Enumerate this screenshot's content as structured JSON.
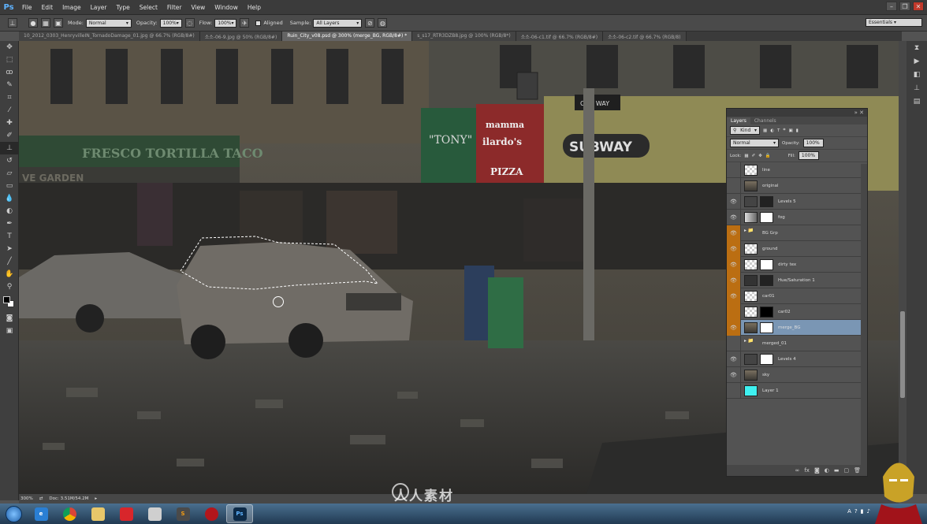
{
  "app": {
    "logo": "Ps"
  },
  "menu": [
    "File",
    "Edit",
    "Image",
    "Layer",
    "Type",
    "Select",
    "Filter",
    "View",
    "Window",
    "Help"
  ],
  "window_controls": [
    "minimize-icon",
    "restore-icon",
    "close-icon"
  ],
  "options": {
    "mode_label": "Mode:",
    "mode_value": "Normal",
    "opacity_label": "Opacity:",
    "opacity_value": "100%",
    "flow_label": "Flow:",
    "flow_value": "100%",
    "aligned_label": "Aligned",
    "sample_label": "Sample:",
    "sample_value": "All Layers",
    "workspace": "Essentials"
  },
  "tabs": [
    "10_2012_0303_HenryvilleIN_TornadoDamage_01.jpg @ 66.7% (RGB/8#)",
    "소소-06-9.jpg @ 50% (RGB/8#)",
    "Ruin_City_v08.psd @ 300% (merge_BG, RGB/8#) *",
    "s_s17_RTR3DZB8.jpg @ 100% (RGB/8*)",
    "소소-06-c1.tif @ 66.7% (RGB/8#)",
    "소소-06-c2.tif @ 66.7% (RGB/8)"
  ],
  "status": {
    "zoom": "300%",
    "doc": "Doc: 3.51M/54.2M"
  },
  "scene": {
    "signs": [
      "FRESCO TORTILLA TACO",
      "VE GARDEN",
      "\"TONY\"",
      "mamma",
      "ilardo's",
      "PIZZA",
      "SUBWAY",
      "ONE WAY"
    ]
  },
  "layers_panel": {
    "tabs": [
      "Layers",
      "Channels"
    ],
    "filter_kind": "Kind",
    "blend_mode": "Normal",
    "opacity_label": "Opacity:",
    "opacity_value": "100%",
    "lock_label": "Lock:",
    "fill_label": "Fill:",
    "fill_value": "100%",
    "layers": [
      {
        "name": "line",
        "visible": false,
        "orange": false,
        "thumb": "checker",
        "mask": ""
      },
      {
        "name": "original",
        "visible": false,
        "orange": false,
        "thumb": "photo",
        "mask": ""
      },
      {
        "name": "Levels 5",
        "visible": true,
        "orange": false,
        "thumb": "levels",
        "mask": "dark"
      },
      {
        "name": "fog",
        "visible": true,
        "orange": false,
        "thumb": "gray",
        "mask": "white"
      },
      {
        "name": "BG Grp",
        "visible": true,
        "orange": true,
        "thumb": "folder",
        "mask": ""
      },
      {
        "name": "ground",
        "visible": true,
        "orange": true,
        "thumb": "checker",
        "mask": ""
      },
      {
        "name": "dirty tex",
        "visible": true,
        "orange": true,
        "thumb": "checker",
        "mask": "white"
      },
      {
        "name": "Hue/Saturation 1",
        "visible": true,
        "orange": true,
        "thumb": "hue",
        "mask": "dark"
      },
      {
        "name": "car01",
        "visible": true,
        "orange": true,
        "thumb": "checker",
        "mask": ""
      },
      {
        "name": "car02",
        "visible": false,
        "orange": true,
        "thumb": "checker",
        "mask": "black"
      },
      {
        "name": "merge_BG",
        "visible": true,
        "orange": true,
        "thumb": "photo",
        "mask": "white",
        "selected": true
      },
      {
        "name": "merged_01",
        "visible": false,
        "orange": false,
        "thumb": "folder",
        "mask": ""
      },
      {
        "name": "Levels 4",
        "visible": true,
        "orange": false,
        "thumb": "levels",
        "mask": "white"
      },
      {
        "name": "sky",
        "visible": true,
        "orange": false,
        "thumb": "photo",
        "mask": ""
      },
      {
        "name": "Layer 1",
        "visible": false,
        "orange": false,
        "thumb": "cyan",
        "mask": ""
      }
    ]
  },
  "taskbar": {
    "apps": [
      "ie-icon",
      "chrome-icon",
      "explorer-icon",
      "app-red-icon",
      "app-dice-icon",
      "sublime-icon",
      "ladybug-icon",
      "photoshop-icon"
    ],
    "ps_label": "Ps",
    "tray_text": "A"
  },
  "watermark": "人人素材",
  "colors": {
    "accent_selected": "#7a96b4",
    "group_orange": "#bb6e12",
    "ps_blue": "#5fb3ff",
    "cyan_layer": "#3ff1f1"
  }
}
